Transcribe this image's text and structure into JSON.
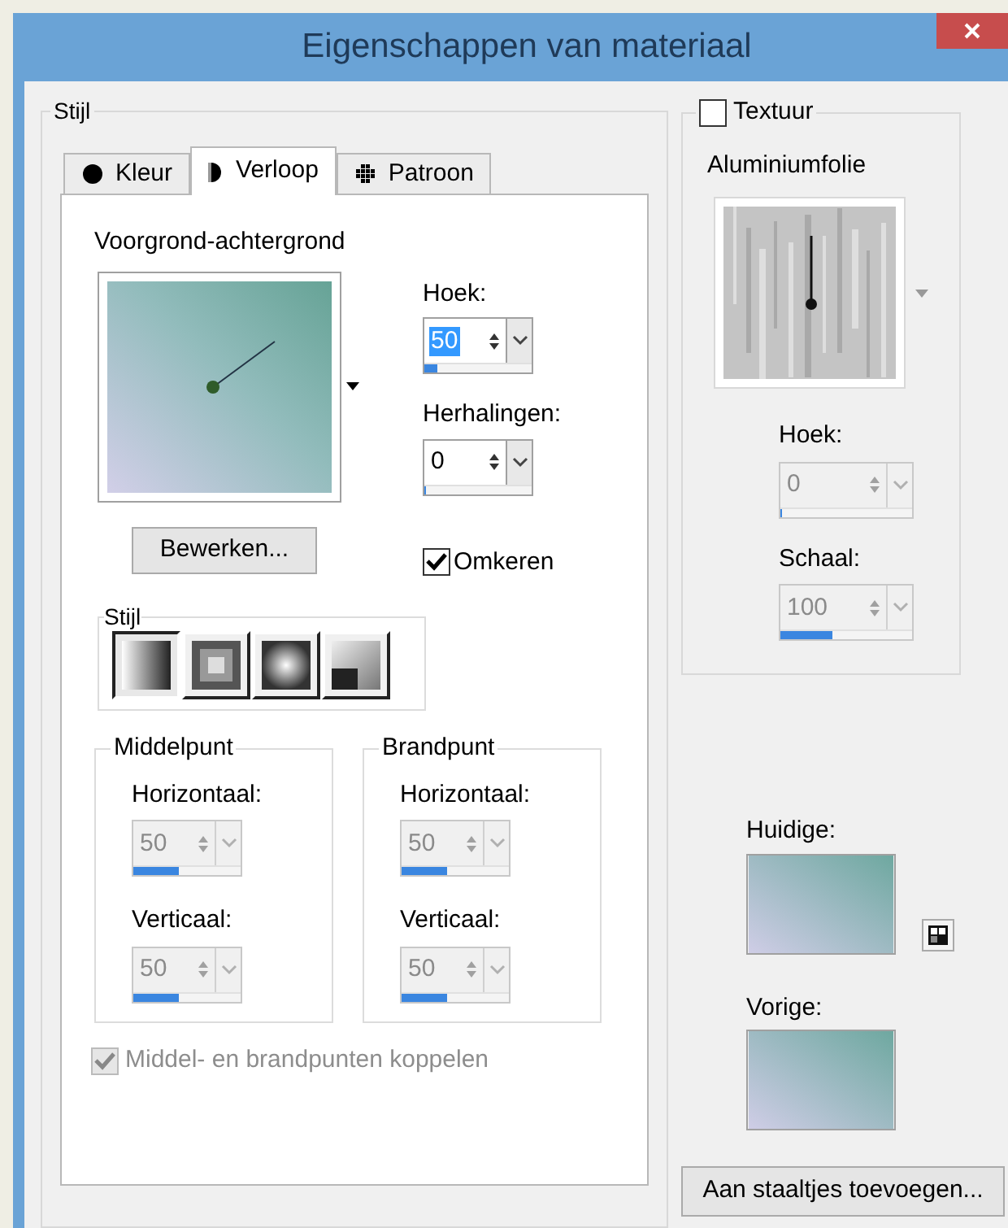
{
  "window": {
    "title": "Eigenschappen van materiaal"
  },
  "style_group": {
    "label": "Stijl",
    "tabs": [
      {
        "label": "Kleur",
        "selected": false,
        "kind": "color"
      },
      {
        "label": "Verloop",
        "selected": true,
        "kind": "gradient"
      },
      {
        "label": "Patroon",
        "selected": false,
        "kind": "pattern"
      }
    ],
    "gradient_name": "Voorgrond-achtergrond",
    "angle": {
      "label": "Hoek:",
      "value": "50",
      "highlighted": true,
      "disabled": false,
      "level": 0.12
    },
    "repeats": {
      "label": "Herhalingen:",
      "value": "0",
      "highlighted": false,
      "disabled": false,
      "level": 0
    },
    "edit_button": "Bewerken...",
    "invert": {
      "label": "Omkeren",
      "checked": true
    },
    "style_types": {
      "label": "Stijl",
      "items": [
        {
          "kind": "linear",
          "selected": true
        },
        {
          "kind": "rectangular",
          "selected": false
        },
        {
          "kind": "sunburst",
          "selected": false
        },
        {
          "kind": "corner",
          "selected": false
        }
      ]
    },
    "points": [
      {
        "label": "Middelpunt",
        "fields": [
          {
            "label": "Horizontaal:",
            "value": "50",
            "highlighted": false,
            "disabled": true,
            "level": 0.42
          },
          {
            "label": "Verticaal:",
            "value": "50",
            "highlighted": false,
            "disabled": true,
            "level": 0.42
          }
        ]
      },
      {
        "label": "Brandpunt",
        "fields": [
          {
            "label": "Horizontaal:",
            "value": "50",
            "highlighted": false,
            "disabled": true,
            "level": 0.42
          },
          {
            "label": "Verticaal:",
            "value": "50",
            "highlighted": false,
            "disabled": true,
            "level": 0.42
          }
        ]
      }
    ],
    "link": {
      "label": "Middel- en brandpunten koppelen",
      "checked": true,
      "disabled": true
    }
  },
  "texture_group": {
    "label": "Textuur",
    "checked": false,
    "name": "Aluminiumfolie",
    "fields": [
      {
        "label": "Hoek:",
        "value": "0",
        "highlighted": false,
        "disabled": true,
        "level": 0
      },
      {
        "label": "Schaal:",
        "value": "100",
        "highlighted": false,
        "disabled": true,
        "level": 0.4
      }
    ]
  },
  "current": {
    "label": "Huidige:"
  },
  "previous": {
    "label": "Vorige:"
  },
  "add_button": "Aan staaltjes toevoegen..."
}
